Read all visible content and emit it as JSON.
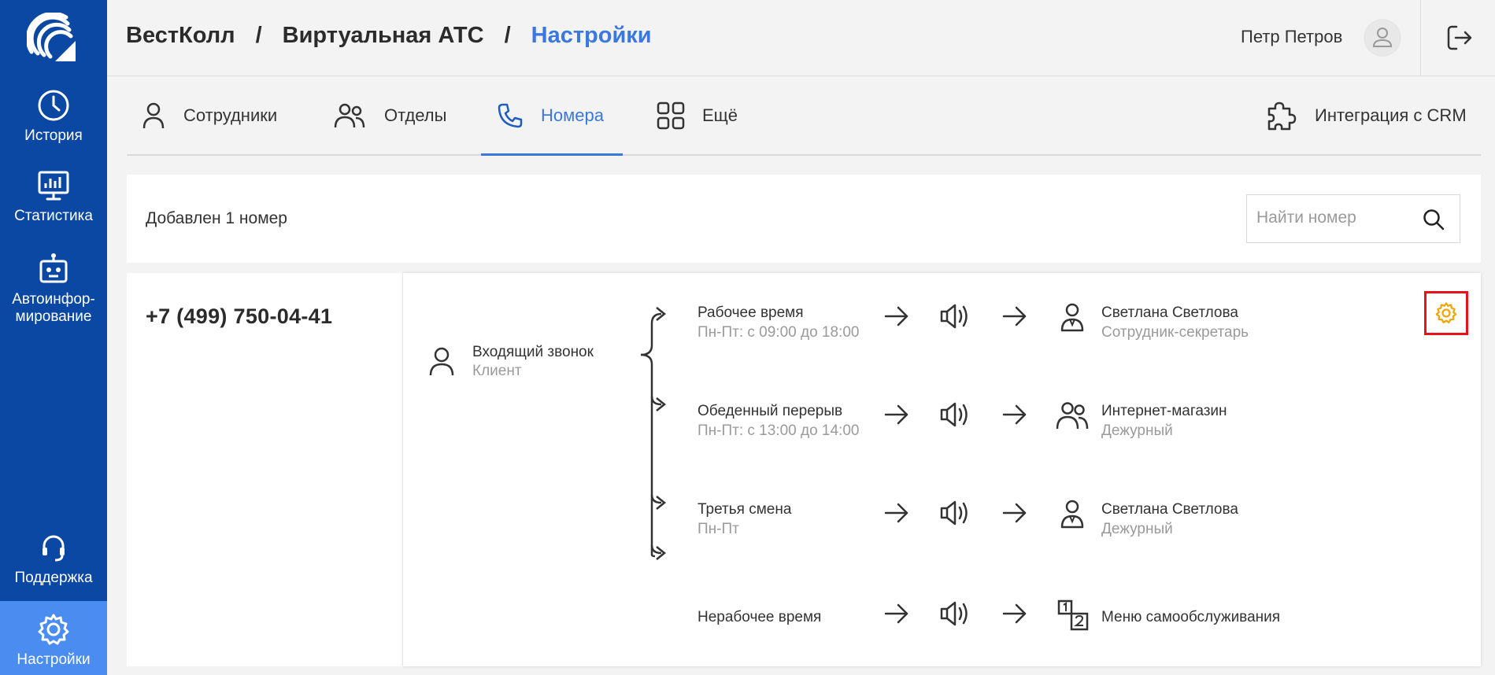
{
  "sidebar": {
    "items": [
      {
        "label": "История",
        "icon": "clock-icon"
      },
      {
        "label": "Статистика",
        "icon": "monitor-chart-icon"
      },
      {
        "label": "Автоинфор-мирование",
        "icon": "robot-icon"
      },
      {
        "label": "Поддержка",
        "icon": "headset-icon"
      },
      {
        "label": "Настройки",
        "icon": "gear-icon"
      }
    ],
    "active_color": "#4a8cf0",
    "background": "#0b48a3"
  },
  "header": {
    "breadcrumbs": [
      "ВестКолл",
      "Виртуальная АТС",
      "Настройки"
    ],
    "separator": "/",
    "user_name": "Петр Петров"
  },
  "tabs": {
    "items": [
      {
        "label": "Сотрудники",
        "icon": "person-icon"
      },
      {
        "label": "Отделы",
        "icon": "people-icon"
      },
      {
        "label": "Номера",
        "icon": "phone-icon",
        "active": true
      },
      {
        "label": "Ещё",
        "icon": "grid-icon"
      }
    ],
    "integration_label": "Интеграция с CRM"
  },
  "numbers": {
    "count_text": "Добавлен 1 номер",
    "search_placeholder": "Найти номер"
  },
  "number": {
    "phone": "+7 (499) 750-04-41",
    "incoming": {
      "title": "Входящий звонок",
      "subtitle": "Клиент"
    },
    "rules": [
      {
        "title": "Рабочее время",
        "subtitle": "Пн-Пт: с 09:00 до 18:00",
        "target_title": "Светлана Светлова",
        "target_subtitle": "Сотрудник-секретарь",
        "target_icon": "employee-icon"
      },
      {
        "title": "Обеденный перерыв",
        "subtitle": "Пн-Пт: с 13:00 до 14:00",
        "target_title": "Интернет-магазин",
        "target_subtitle": "Дежурный",
        "target_icon": "department-icon"
      },
      {
        "title": "Третья смена",
        "subtitle": "Пн-Пт",
        "target_title": "Светлана Светлова",
        "target_subtitle": "Дежурный",
        "target_icon": "employee-icon"
      },
      {
        "title": "Нерабочее время",
        "subtitle": "",
        "target_title": "Меню самообслуживания",
        "target_subtitle": "",
        "target_icon": "ivr-menu-icon"
      }
    ],
    "settings_highlight_color": "#e8121b",
    "settings_icon_color": "#f0a500"
  }
}
